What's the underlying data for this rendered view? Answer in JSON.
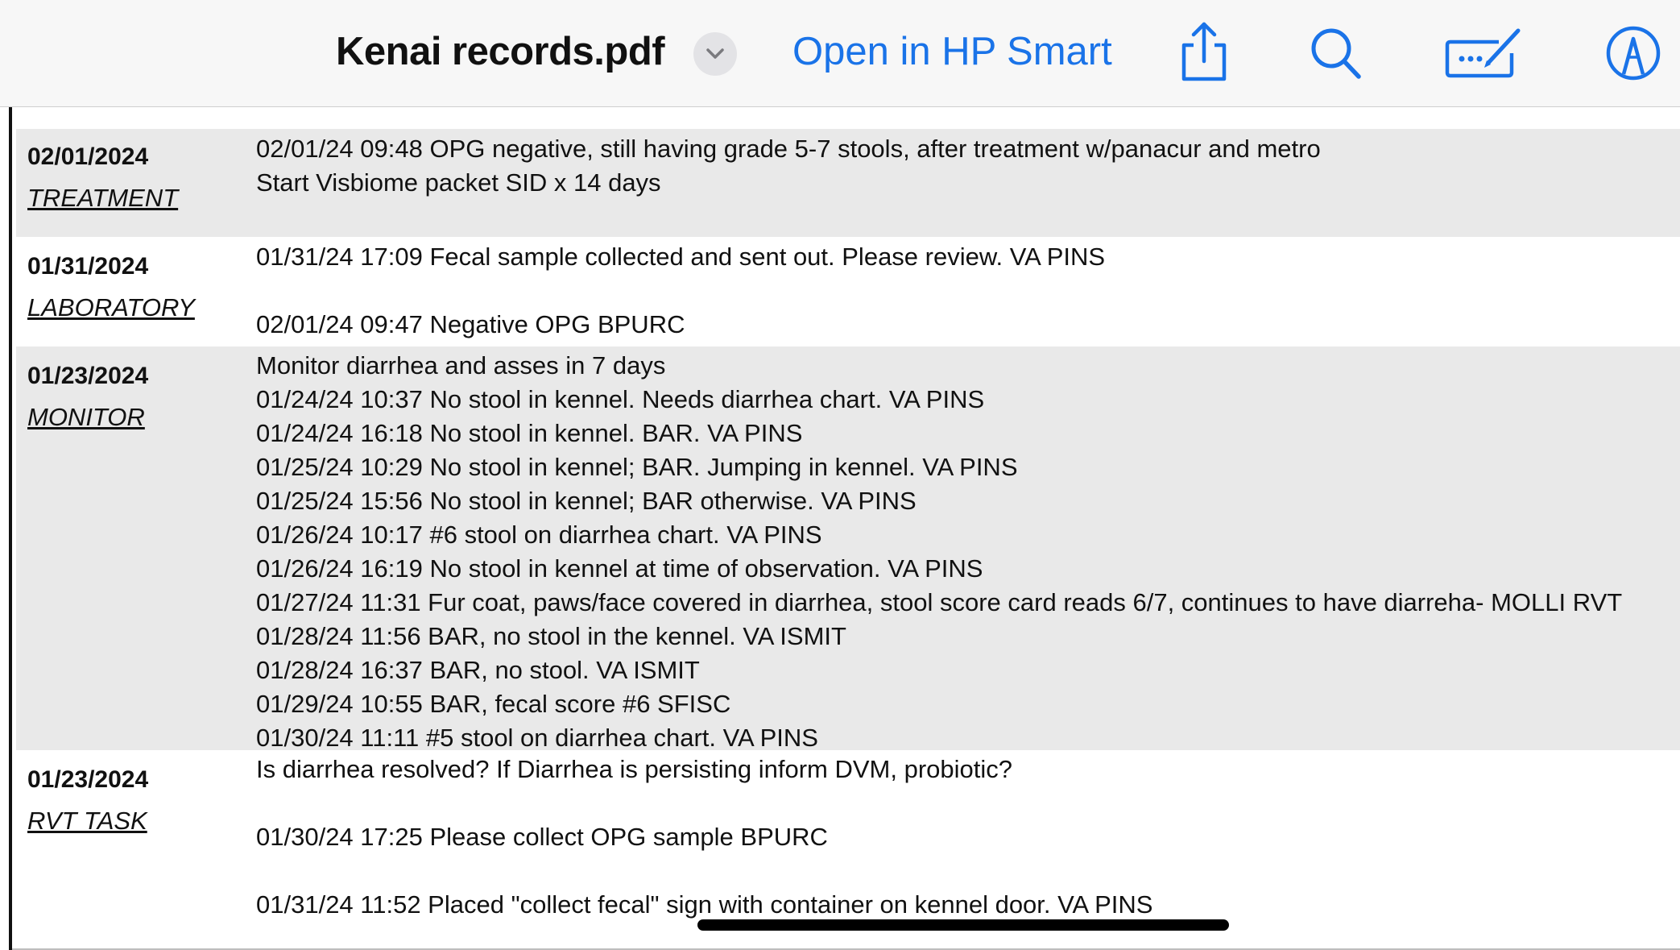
{
  "toolbar": {
    "doc_title": "Kenai records.pdf",
    "open_in_label": "Open in HP Smart",
    "icons": [
      "chevron-down-icon",
      "share-icon",
      "search-icon",
      "markup-icon",
      "pen-circle-icon"
    ],
    "accent_color": "#1a73e8"
  },
  "records": [
    {
      "date": "02/01/2024",
      "category": "TREATMENT",
      "lines": [
        "02/01/24 09:48 OPG negative, still having grade 5-7 stools, after treatment w/panacur and metro",
        "Start Visbiome packet SID x 14 days"
      ]
    },
    {
      "date": "01/31/2024",
      "category": "LABORATORY",
      "lines": [
        "01/31/24 17:09 Fecal sample collected and sent out. Please review.  VA PINS",
        "",
        "02/01/24 09:47 Negative OPG BPURC"
      ]
    },
    {
      "date": "01/23/2024",
      "category": "MONITOR",
      "lines": [
        "Monitor diarrhea and asses in 7 days",
        "01/24/24 10:37 No stool in kennel. Needs diarrhea chart.  VA PINS",
        "01/24/24 16:18 No stool in kennel. BAR.  VA PINS",
        "01/25/24 10:29 No stool in kennel; BAR. Jumping in kennel.  VA PINS",
        "01/25/24 15:56 No stool in kennel; BAR otherwise.  VA PINS",
        "01/26/24 10:17 #6 stool on diarrhea chart.  VA PINS",
        "01/26/24 16:19 No stool in kennel at time of observation.  VA PINS",
        "01/27/24 11:31 Fur coat, paws/face covered in diarrhea, stool score card reads 6/7, continues to have diarreha-  MOLLI RVT",
        "01/28/24 11:56 BAR, no stool in the kennel.  VA ISMIT",
        "01/28/24 16:37 BAR, no stool.  VA ISMIT",
        "01/29/24 10:55 BAR, fecal score #6 SFISC",
        "01/30/24 11:11 #5 stool on diarrhea chart.  VA PINS"
      ]
    },
    {
      "date": "01/23/2024",
      "category": "RVT TASK",
      "lines": [
        "Is diarrhea resolved? If Diarrhea is persisting inform DVM, probiotic?",
        "",
        "01/30/24 17:25 Please collect OPG sample BPURC",
        "",
        "01/31/24 11:52 Placed \"collect fecal\" sign with container on kennel door.  VA PINS"
      ]
    }
  ]
}
